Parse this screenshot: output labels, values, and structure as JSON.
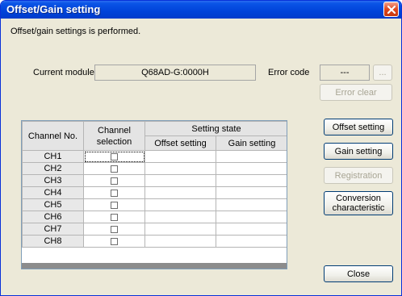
{
  "window": {
    "title": "Offset/Gain setting"
  },
  "intro_text": "Offset/gain settings is performed.",
  "current_module": {
    "label": "Current module",
    "value": "Q68AD-G:0000H"
  },
  "error_code": {
    "label": "Error code",
    "value": "---",
    "browse_label": "...",
    "clear_label": "Error clear"
  },
  "table": {
    "headers": {
      "channel_no": "Channel No.",
      "channel_selection": "Channel selection",
      "setting_state": "Setting state",
      "offset_setting": "Offset setting",
      "gain_setting": "Gain setting"
    },
    "rows": [
      {
        "channel": "CH1",
        "selected": false,
        "offset": "",
        "gain": ""
      },
      {
        "channel": "CH2",
        "selected": false,
        "offset": "",
        "gain": ""
      },
      {
        "channel": "CH3",
        "selected": false,
        "offset": "",
        "gain": ""
      },
      {
        "channel": "CH4",
        "selected": false,
        "offset": "",
        "gain": ""
      },
      {
        "channel": "CH5",
        "selected": false,
        "offset": "",
        "gain": ""
      },
      {
        "channel": "CH6",
        "selected": false,
        "offset": "",
        "gain": ""
      },
      {
        "channel": "CH7",
        "selected": false,
        "offset": "",
        "gain": ""
      },
      {
        "channel": "CH8",
        "selected": false,
        "offset": "",
        "gain": ""
      }
    ]
  },
  "buttons": {
    "offset_setting": "Offset setting",
    "gain_setting": "Gain setting",
    "registration": "Registration",
    "conversion_characteristic": "Conversion characteristic",
    "close": "Close"
  },
  "colors": {
    "titlebar": "#0043d9",
    "window_bg": "#ece9d8",
    "close_button": "#e0461c"
  }
}
